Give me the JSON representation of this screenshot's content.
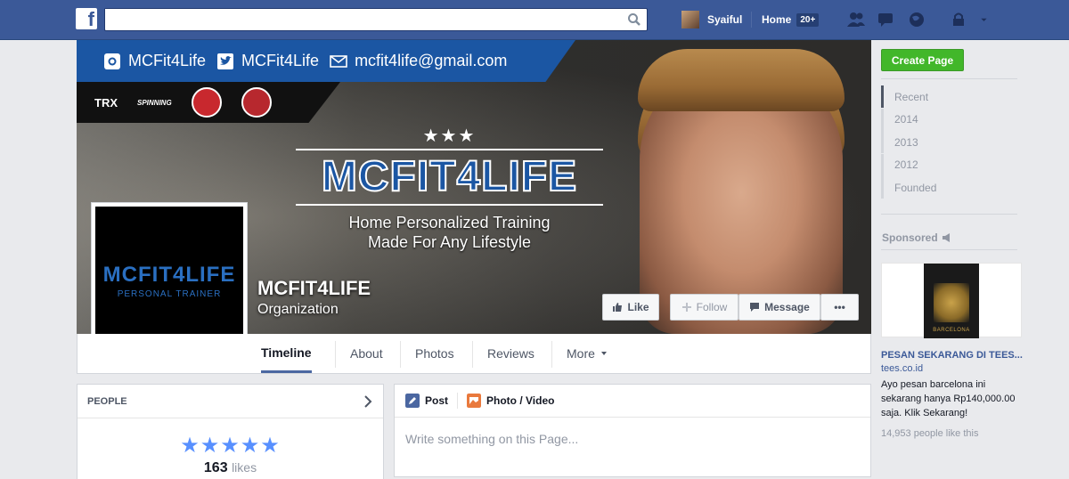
{
  "topbar": {
    "search_placeholder": "",
    "user_name": "Syaiful",
    "home_label": "Home",
    "home_badge": "20+"
  },
  "cover": {
    "social": [
      {
        "icon": "instagram-icon",
        "text": "MCFit4Life"
      },
      {
        "icon": "twitter-icon",
        "text": "MCFit4Life"
      },
      {
        "icon": "mail-icon",
        "text": "mcfit4life@gmail.com"
      }
    ],
    "sponsor_logos": [
      "TRX",
      "SPINNING"
    ],
    "brand_stars": "★★★",
    "brand_title": "MCFIT4LIFE",
    "tagline_1": "Home Personalized Training",
    "tagline_2": "Made For Any Lifestyle"
  },
  "profile": {
    "pic_title": "MCFIT4LIFE",
    "pic_sub": "PERSONAL TRAINER",
    "name": "MCFIT4LIFE",
    "category": "Organization"
  },
  "actions": {
    "like": "Like",
    "follow": "Follow",
    "message": "Message",
    "more": "•••"
  },
  "tabs": [
    "Timeline",
    "About",
    "Photos",
    "Reviews",
    "More"
  ],
  "people": {
    "header": "PEOPLE",
    "stars": "★★★★★",
    "likes_count": "163",
    "likes_label": "likes"
  },
  "composer": {
    "post_label": "Post",
    "photo_label": "Photo / Video",
    "placeholder": "Write something on this Page..."
  },
  "sidebar": {
    "create_page": "Create Page",
    "years": [
      "Recent",
      "2014",
      "2013",
      "2012",
      "Founded"
    ],
    "sponsored": "Sponsored",
    "ad_shirt_text": "BARCELONA",
    "ad_title": "PESAN SEKARANG DI TEES...",
    "ad_domain": "tees.co.id",
    "ad_body": "Ayo pesan barcelona ini sekarang hanya Rp140,000.00 saja. Klik Sekarang!",
    "ad_social": "14,953 people like this"
  },
  "colors": {
    "fb_blue": "#3b5998",
    "brand_blue": "#1b56a3",
    "create_green": "#42b72a",
    "tab_underline": "#4b67a1"
  }
}
